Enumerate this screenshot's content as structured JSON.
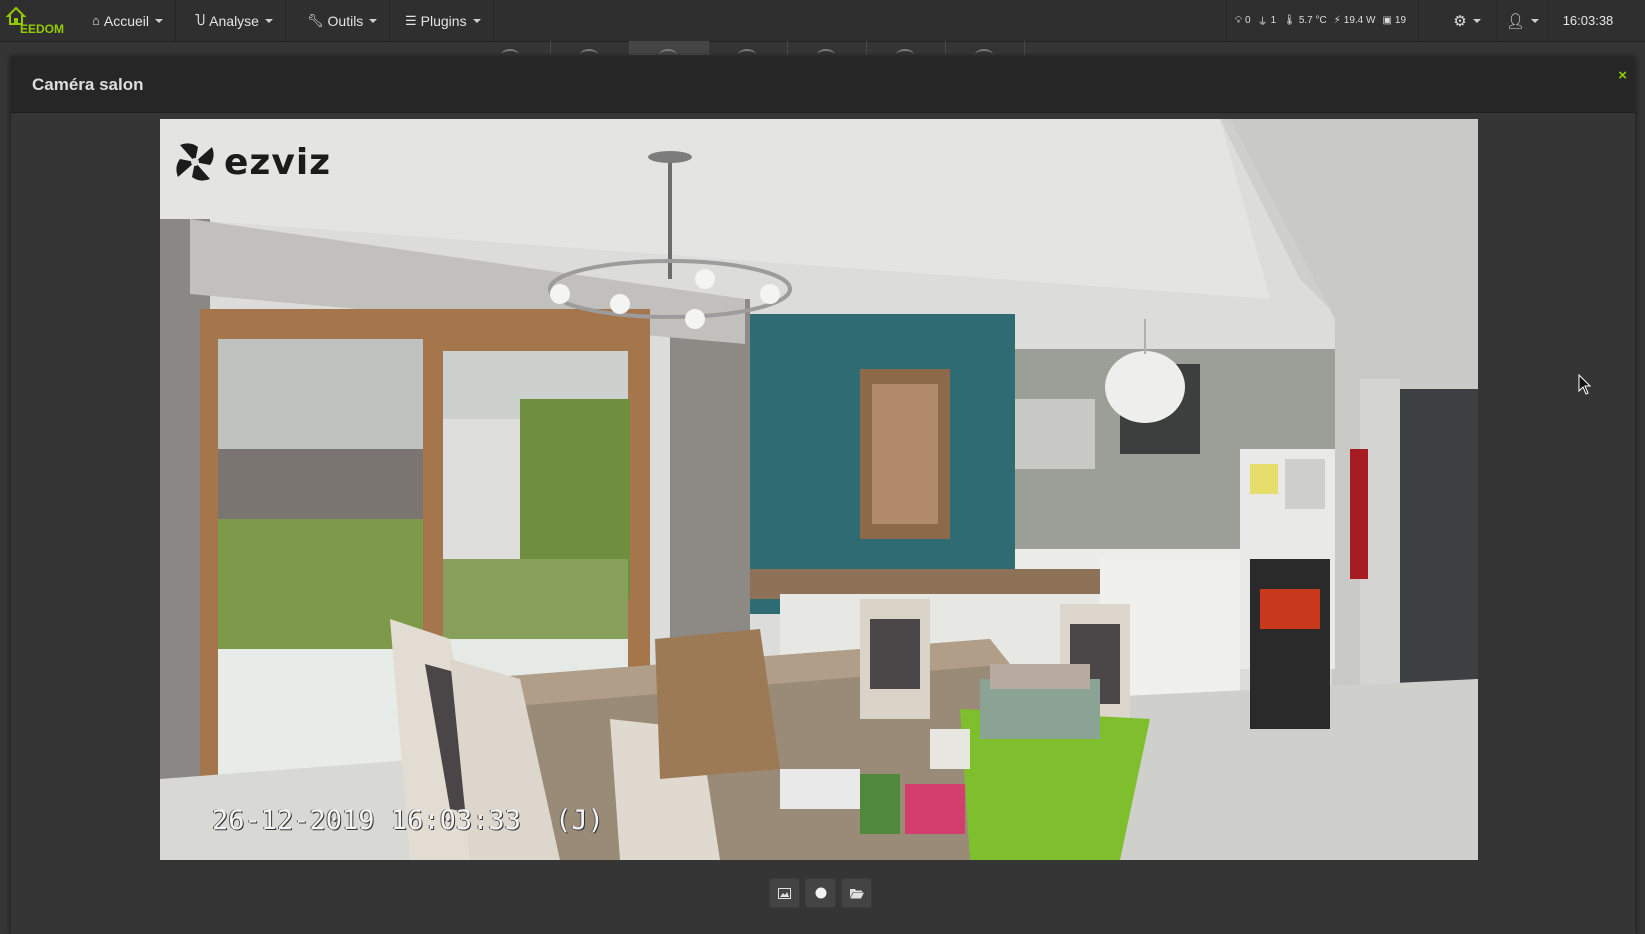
{
  "app": {
    "logo_text": "EEDOM"
  },
  "menu": [
    {
      "label": "Accueil",
      "icon": "home-icon"
    },
    {
      "label": "Analyse",
      "icon": "magnet-icon"
    },
    {
      "label": "Outils",
      "icon": "wrench-icon"
    },
    {
      "label": "Plugins",
      "icon": "list-icon"
    }
  ],
  "summary": {
    "lights": "0",
    "plugs": "1",
    "temperature": "5.7 °C",
    "power": "19.4 W",
    "devices": "19"
  },
  "clock": "16:03:38",
  "modal": {
    "title": "Caméra salon",
    "close_label": "×"
  },
  "camera": {
    "brand": "ezviz",
    "timestamp": "26-12-2019 16:03:33",
    "weekday": "(J)"
  },
  "colors": {
    "accent": "#93ca02",
    "navbar": "#2f2f2f",
    "modal_header": "#262626",
    "background": "#353535"
  }
}
